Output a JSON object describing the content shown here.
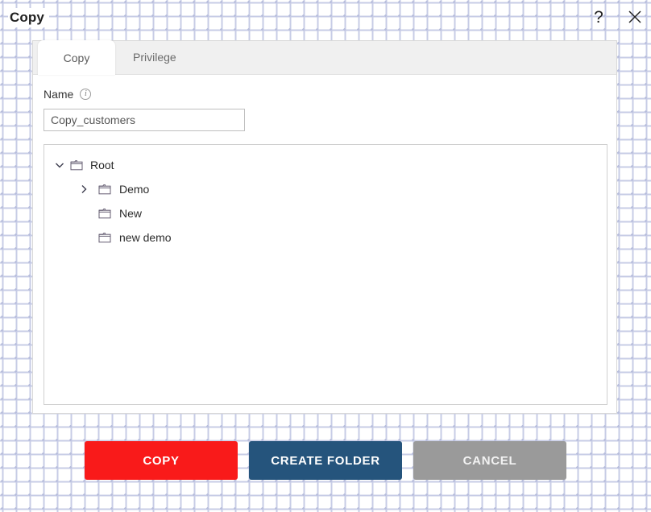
{
  "header": {
    "title": "Copy",
    "help_icon": "question-mark-icon",
    "close_icon": "close-icon"
  },
  "tabs": [
    {
      "label": "Copy",
      "active": true
    },
    {
      "label": "Privilege",
      "active": false
    }
  ],
  "form": {
    "name_label": "Name",
    "info_icon_glyph": "i",
    "name_value": "Copy_customers",
    "name_placeholder": "Name"
  },
  "tree": {
    "nodes": [
      {
        "label": "Root",
        "depth": 0,
        "state": "expanded",
        "chevron": "chevron-down-icon",
        "icon": "folder-icon"
      },
      {
        "label": "Demo",
        "depth": 1,
        "state": "collapsed",
        "chevron": "chevron-right-icon",
        "icon": "folder-icon"
      },
      {
        "label": "New",
        "depth": 1,
        "state": "leaf",
        "chevron": "",
        "icon": "folder-icon"
      },
      {
        "label": "new demo",
        "depth": 1,
        "state": "leaf",
        "chevron": "",
        "icon": "folder-icon"
      }
    ]
  },
  "buttons": {
    "copy": "COPY",
    "create_folder": "CREATE FOLDER",
    "cancel": "CANCEL"
  },
  "colors": {
    "copy_red": "#f91a1a",
    "create_folder_blue": "#25547c",
    "cancel_gray": "#9a9a9a",
    "pattern_dot": "#c7cce6",
    "panel_border": "#d8d8d8",
    "tab_bar": "#f0f0f0"
  }
}
